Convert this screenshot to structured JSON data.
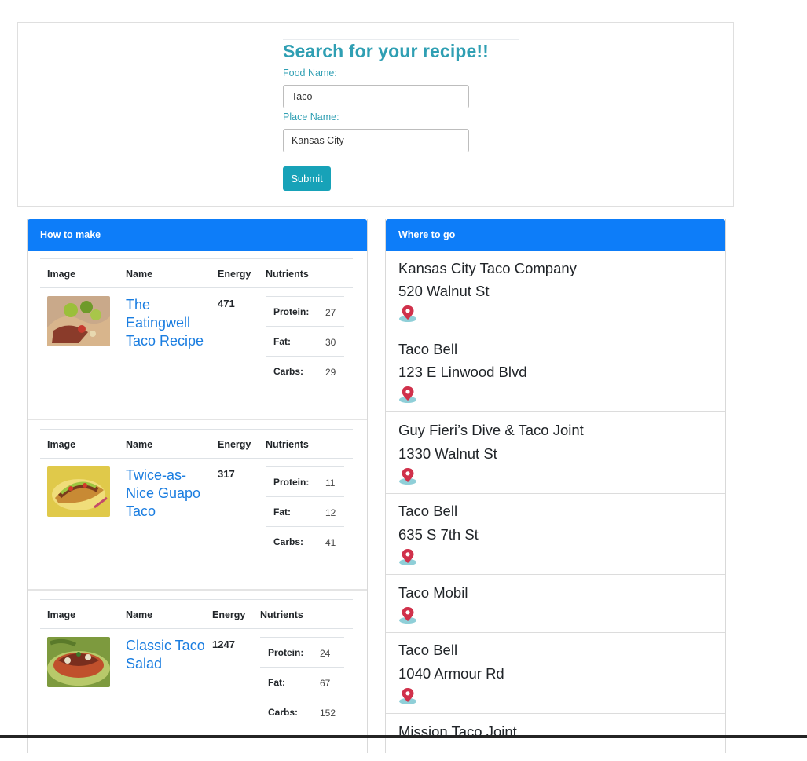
{
  "search": {
    "title": "Search for your recipe!!",
    "food_label": "Food Name:",
    "food_value": "Taco",
    "place_label": "Place Name:",
    "place_value": "Kansas City",
    "submit_label": "Submit"
  },
  "how_to_make": {
    "header": "How to make",
    "columns": [
      "Image",
      "Name",
      "Energy",
      "Nutrients"
    ],
    "recipes": [
      {
        "name": "The Eatingwell Taco Recipe",
        "energy": "471",
        "protein_label": "Protein:",
        "protein": "27",
        "fat_label": "Fat:",
        "fat": "30",
        "carbs_label": "Carbs:",
        "carbs": "29"
      },
      {
        "name": "Twice-as-Nice Guapo Taco",
        "energy": "317",
        "protein_label": "Protein:",
        "protein": "11",
        "fat_label": "Fat:",
        "fat": "12",
        "carbs_label": "Carbs:",
        "carbs": "41"
      },
      {
        "name": "Classic Taco Salad",
        "energy": "1247",
        "protein_label": "Protein:",
        "protein": "24",
        "fat_label": "Fat:",
        "fat": "67",
        "carbs_label": "Carbs:",
        "carbs": "152"
      }
    ]
  },
  "where_to_go": {
    "header": "Where to go",
    "places": [
      {
        "name": "Kansas City Taco Company",
        "address": "520 Walnut St"
      },
      {
        "name": "Taco Bell",
        "address": "123 E Linwood Blvd"
      },
      {
        "name": "Guy Fieri’s Dive & Taco Joint",
        "address": "1330 Walnut St"
      },
      {
        "name": "Taco Bell",
        "address": "635 S 7th St"
      },
      {
        "name": "Taco Mobil",
        "address": ""
      },
      {
        "name": "Taco Bell",
        "address": "1040 Armour Rd"
      },
      {
        "name": "Mission Taco Joint",
        "address": ""
      }
    ]
  },
  "colors": {
    "accent": "#17a2b8",
    "header_blue": "#0d7df9",
    "link_blue": "#1a7de0",
    "pin_red": "#d0314b"
  },
  "icons": {
    "place_pin": "map-pin-icon"
  }
}
